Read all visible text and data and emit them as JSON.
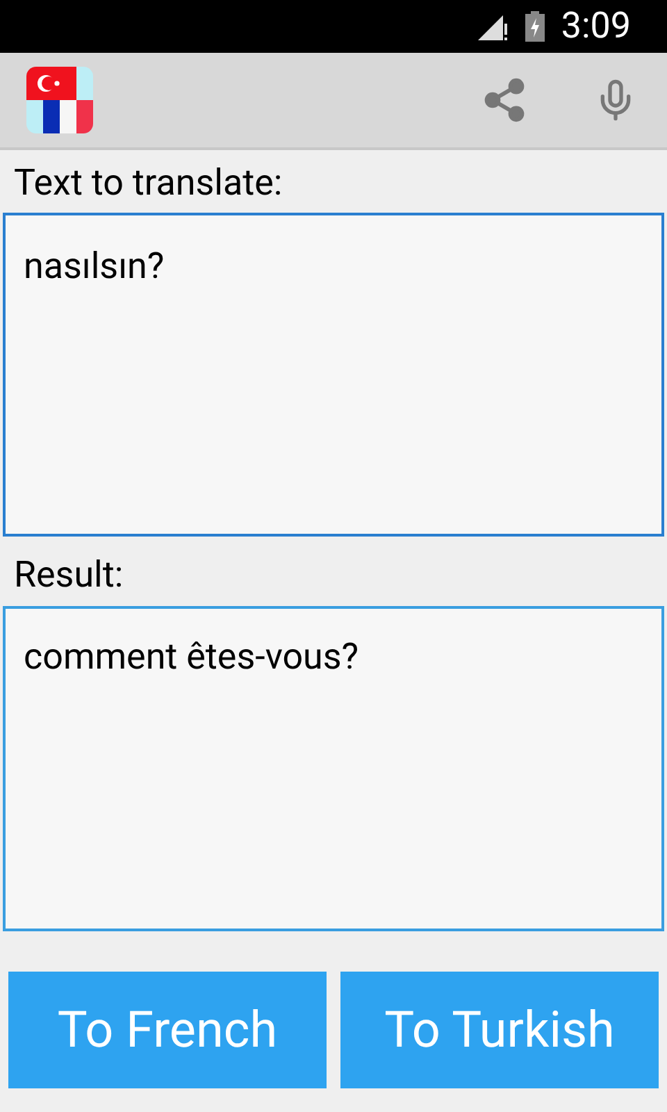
{
  "status_bar": {
    "time": "3:09"
  },
  "input": {
    "label": "Text to translate:",
    "value": "nasılsın?"
  },
  "result": {
    "label": "Result:",
    "value": "comment êtes-vous?"
  },
  "buttons": [
    {
      "label": "To French"
    },
    {
      "label": "To Turkish"
    }
  ]
}
